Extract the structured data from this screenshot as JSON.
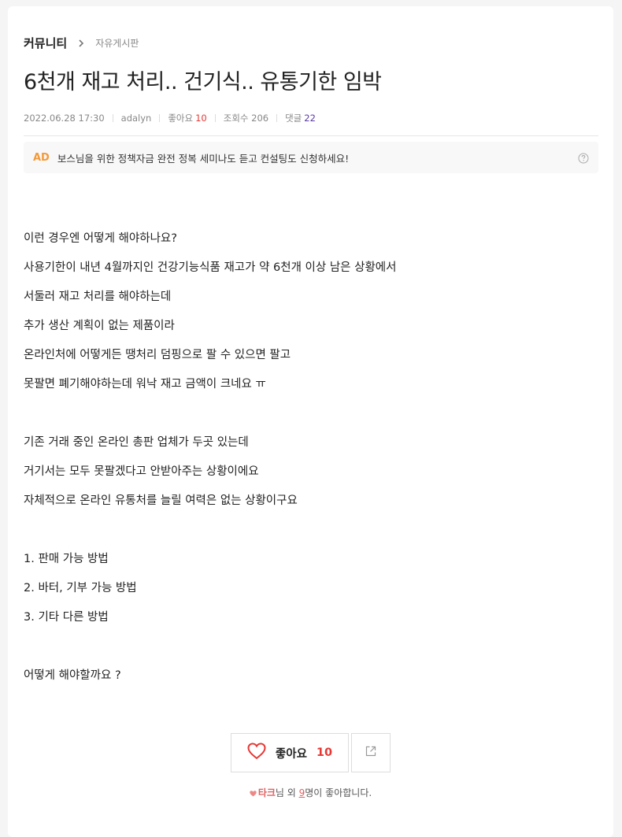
{
  "breadcrumb": {
    "section": "커뮤니티",
    "board": "자유게시판"
  },
  "post": {
    "title": "6천개 재고 처리.. 건기식.. 유통기한 임박",
    "date": "2022.06.28 17:30",
    "author": "adalyn",
    "likes_label": "좋아요",
    "likes_count": "10",
    "views_label": "조회수",
    "views_count": "206",
    "comments_label": "댓글",
    "comments_count": "22"
  },
  "ad": {
    "tag": "AD",
    "text": "보스님을 위한 정책자금 완전 정복 세미나도 듣고 컨설팅도 신청하세요!",
    "help_icon": "question-circle-icon"
  },
  "body": [
    "이런 경우엔 어떻게 해야하나요?",
    "사용기한이 내년 4월까지인 건강기능식품 재고가 약 6천개 이상 남은 상황에서",
    "서둘러 재고 처리를 해야하는데",
    "추가 생산 계획이 없는 제품이라",
    "온라인처에 어떻게든 땡처리 덤핑으로 팔 수 있으면 팔고",
    "못팔면 폐기해야하는데 워낙 재고 금액이 크네요 ㅠ",
    "",
    "기존 거래 중인 온라인 총판 업체가 두곳 있는데",
    "거기서는 모두 못팔겠다고 안받아주는 상황이에요",
    "자체적으로 온라인 유통처를 늘릴 여력은 없는 상황이구요",
    "",
    "1. 판매 가능 방법",
    "2. 바터, 기부 가능 방법",
    "3. 기타 다른 방법",
    "",
    "어떻게 해야할까요 ?"
  ],
  "actions": {
    "like_label": "좋아요",
    "like_count": "10",
    "heart_icon": "heart-outline-icon",
    "share_icon": "share-icon"
  },
  "liked_by": {
    "name": "타크",
    "suffix_1": "님 외 ",
    "others": "9",
    "suffix_2": "명이 좋아합니다."
  },
  "colors": {
    "accent_red": "#e53935",
    "ad_orange": "#f39a3a",
    "comment_purple": "#5b3aa8"
  }
}
